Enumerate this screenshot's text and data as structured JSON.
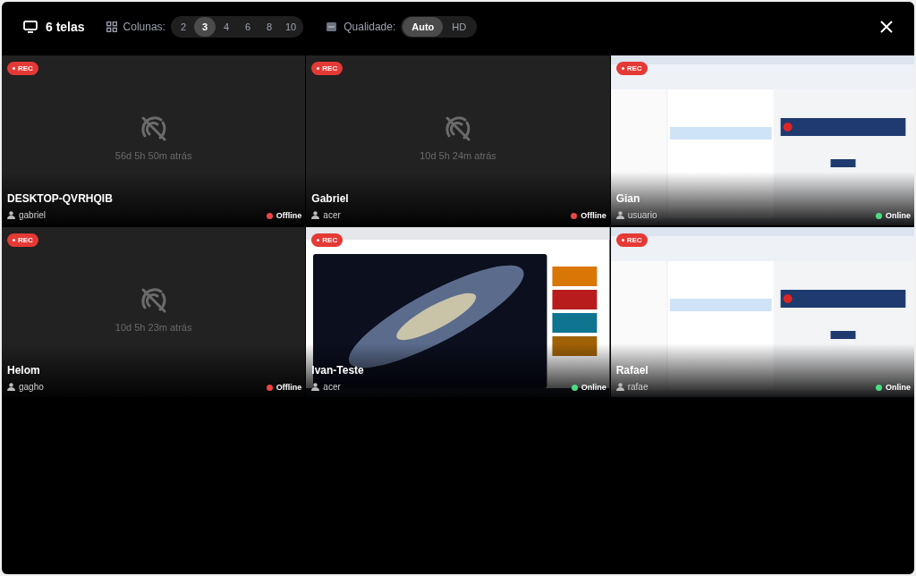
{
  "toolbar": {
    "screens": "6 telas",
    "columns_label": "Colunas:",
    "columns": [
      {
        "label": "2",
        "selected": false
      },
      {
        "label": "3",
        "selected": true
      },
      {
        "label": "4",
        "selected": false
      },
      {
        "label": "6",
        "selected": false
      },
      {
        "label": "8",
        "selected": false
      },
      {
        "label": "10",
        "selected": false
      }
    ],
    "quality_label": "Qualidade:",
    "quality": [
      {
        "label": "Auto",
        "selected": true
      },
      {
        "label": "HD",
        "selected": false
      }
    ]
  },
  "tiles": [
    {
      "kind": "offline",
      "rec": "REC",
      "last_seen": "56d 5h 50m atrás",
      "name": "DESKTOP-QVRHQIB",
      "user": "gabriel",
      "status": "Offline",
      "online": false
    },
    {
      "kind": "offline",
      "rec": "REC",
      "last_seen": "10d 5h 24m atrás",
      "name": "Gabriel",
      "user": "acer",
      "status": "Offline",
      "online": false
    },
    {
      "kind": "live",
      "rec": "REC",
      "name": "Gian",
      "user": "usuario",
      "status": "Online",
      "online": true
    },
    {
      "kind": "offline",
      "rec": "REC",
      "last_seen": "10d 5h 23m atrás",
      "name": "Helom",
      "user": "gagho",
      "status": "Offline",
      "online": false
    },
    {
      "kind": "live",
      "rec": "REC",
      "name": "Ivan-Teste",
      "user": "acer",
      "status": "Online",
      "online": true
    },
    {
      "kind": "live",
      "rec": "REC",
      "name": "Rafael",
      "user": "rafae",
      "status": "Online",
      "online": true
    }
  ]
}
